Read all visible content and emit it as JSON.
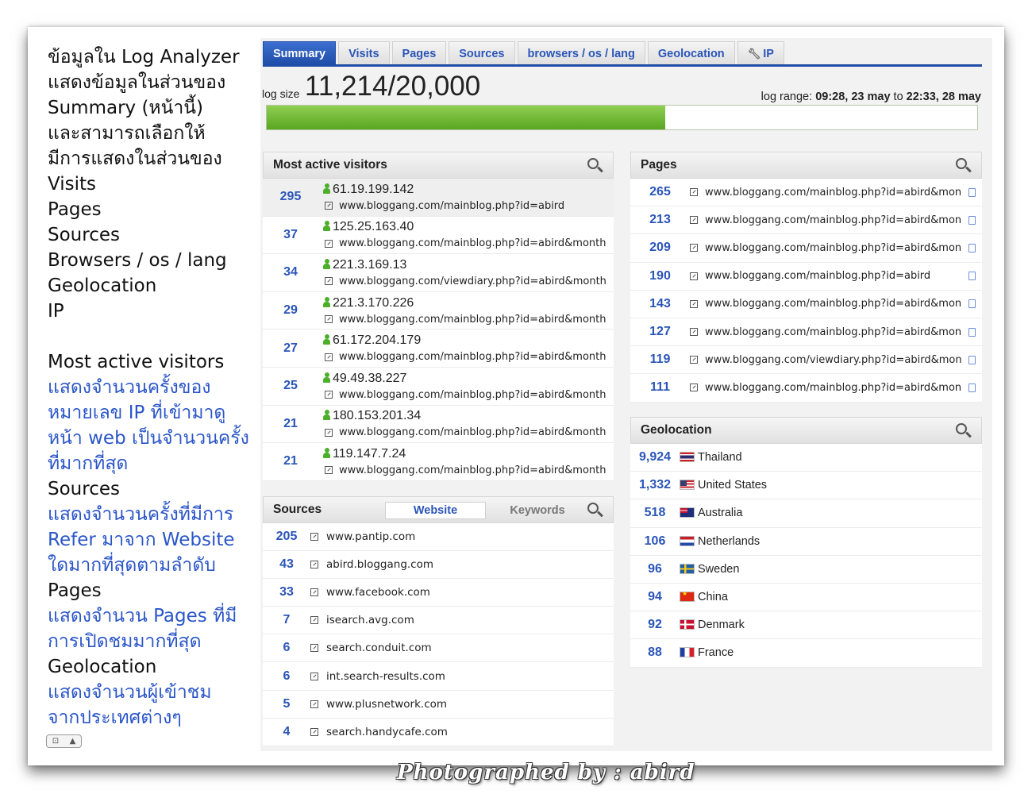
{
  "description": {
    "lines": [
      {
        "text": "ข้อมูลใน Log Analyzer",
        "color": "black"
      },
      {
        "text": "แสดงข้อมูลในส่วนของ",
        "color": "black"
      },
      {
        "text": "Summary (หน้านี้)",
        "color": "black"
      },
      {
        "text": "และสามารถเลือกให้",
        "color": "black"
      },
      {
        "text": "มีการแสดงในส่วนของ",
        "color": "black"
      },
      {
        "text": "Visits",
        "color": "black"
      },
      {
        "text": "Pages",
        "color": "black"
      },
      {
        "text": "Sources",
        "color": "black"
      },
      {
        "text": "Browsers / os / lang",
        "color": "black"
      },
      {
        "text": "Geolocation",
        "color": "black"
      },
      {
        "text": "IP",
        "color": "black"
      },
      {
        "text": "",
        "color": "black"
      },
      {
        "text": "Most active visitors",
        "color": "black"
      },
      {
        "text": "แสดงจำนวนครั้งของ",
        "color": "blue"
      },
      {
        "text": "หมายเลข IP ที่เข้ามาดู",
        "color": "blue"
      },
      {
        "text": "หน้า web เป็นจำนวนครั้ง",
        "color": "blue"
      },
      {
        "text": "ที่มากที่สุด",
        "color": "blue"
      },
      {
        "text": "Sources",
        "color": "black"
      },
      {
        "text": "แสดงจำนวนครั้งที่มีการ",
        "color": "blue"
      },
      {
        "text": "Refer มาจาก Website",
        "color": "blue"
      },
      {
        "text": "ใดมากที่สุดตามลำดับ",
        "color": "blue"
      },
      {
        "text": "Pages",
        "color": "black"
      },
      {
        "text": "แสดงจำนวน Pages ที่มี",
        "color": "blue"
      },
      {
        "text": "การเปิดชมมากที่สุด",
        "color": "blue"
      },
      {
        "text": "Geolocation",
        "color": "black"
      },
      {
        "text": "แสดงจำนวนผู้เข้าชม",
        "color": "blue"
      },
      {
        "text": "จากประเทศต่างๆ",
        "color": "blue"
      }
    ],
    "control_label": "▲"
  },
  "tabs": [
    "Summary",
    "Visits",
    "Pages",
    "Sources",
    "browsers / os / lang",
    "Geolocation",
    "IP"
  ],
  "ip_tab_icon": "wrench-icon",
  "log": {
    "size_label": "log size",
    "size_value": "11,214/20,000",
    "used_fraction": 0.5607,
    "range_label": "log range:",
    "range_start": "09:28, 23 may",
    "range_to": "to",
    "range_end": "22:33, 28 may"
  },
  "visitors": {
    "title": "Most active visitors",
    "rows": [
      {
        "count": "295",
        "ip": "61.19.199.142",
        "url": "www.bloggang.com/mainblog.php?id=abird"
      },
      {
        "count": "37",
        "ip": "125.25.163.40",
        "url": "www.bloggang.com/mainblog.php?id=abird&month"
      },
      {
        "count": "34",
        "ip": "221.3.169.13",
        "url": "www.bloggang.com/viewdiary.php?id=abird&month"
      },
      {
        "count": "29",
        "ip": "221.3.170.226",
        "url": "www.bloggang.com/mainblog.php?id=abird&month"
      },
      {
        "count": "27",
        "ip": "61.172.204.179",
        "url": "www.bloggang.com/mainblog.php?id=abird&month"
      },
      {
        "count": "25",
        "ip": "49.49.38.227",
        "url": "www.bloggang.com/mainblog.php?id=abird&month"
      },
      {
        "count": "21",
        "ip": "180.153.201.34",
        "url": "www.bloggang.com/mainblog.php?id=abird&month"
      },
      {
        "count": "21",
        "ip": "119.147.7.24",
        "url": "www.bloggang.com/mainblog.php?id=abird&month"
      }
    ]
  },
  "pages": {
    "title": "Pages",
    "rows": [
      {
        "count": "265",
        "url": "www.bloggang.com/mainblog.php?id=abird&mon"
      },
      {
        "count": "213",
        "url": "www.bloggang.com/mainblog.php?id=abird&mon"
      },
      {
        "count": "209",
        "url": "www.bloggang.com/mainblog.php?id=abird&mon"
      },
      {
        "count": "190",
        "url": "www.bloggang.com/mainblog.php?id=abird"
      },
      {
        "count": "143",
        "url": "www.bloggang.com/mainblog.php?id=abird&mon"
      },
      {
        "count": "127",
        "url": "www.bloggang.com/mainblog.php?id=abird&mon"
      },
      {
        "count": "119",
        "url": "www.bloggang.com/viewdiary.php?id=abird&mon"
      },
      {
        "count": "111",
        "url": "www.bloggang.com/mainblog.php?id=abird&mon"
      }
    ]
  },
  "sources": {
    "title": "Sources",
    "tab_website": "Website",
    "tab_keywords": "Keywords",
    "rows": [
      {
        "count": "205",
        "site": "www.pantip.com"
      },
      {
        "count": "43",
        "site": "abird.bloggang.com"
      },
      {
        "count": "33",
        "site": "www.facebook.com"
      },
      {
        "count": "7",
        "site": "isearch.avg.com"
      },
      {
        "count": "6",
        "site": "search.conduit.com"
      },
      {
        "count": "6",
        "site": "int.search-results.com"
      },
      {
        "count": "5",
        "site": "www.plusnetwork.com"
      },
      {
        "count": "4",
        "site": "search.handycafe.com"
      }
    ]
  },
  "geolocation": {
    "title": "Geolocation",
    "rows": [
      {
        "count": "9,924",
        "country": "Thailand",
        "flag": "th-flag-icon"
      },
      {
        "count": "1,332",
        "country": "United States",
        "flag": "us-flag-icon"
      },
      {
        "count": "518",
        "country": "Australia",
        "flag": "au-flag-icon"
      },
      {
        "count": "106",
        "country": "Netherlands",
        "flag": "nl-flag-icon"
      },
      {
        "count": "96",
        "country": "Sweden",
        "flag": "se-flag-icon"
      },
      {
        "count": "94",
        "country": "China",
        "flag": "cn-flag-icon"
      },
      {
        "count": "92",
        "country": "Denmark",
        "flag": "dk-flag-icon"
      },
      {
        "count": "88",
        "country": "France",
        "flag": "fr-flag-icon"
      }
    ]
  },
  "watermark": "Photographed by : abird",
  "colors": {
    "accent": "#1f4da8",
    "link": "#2a55b8",
    "progress": "#6ab83a",
    "note_blue": "#2b56c9"
  }
}
